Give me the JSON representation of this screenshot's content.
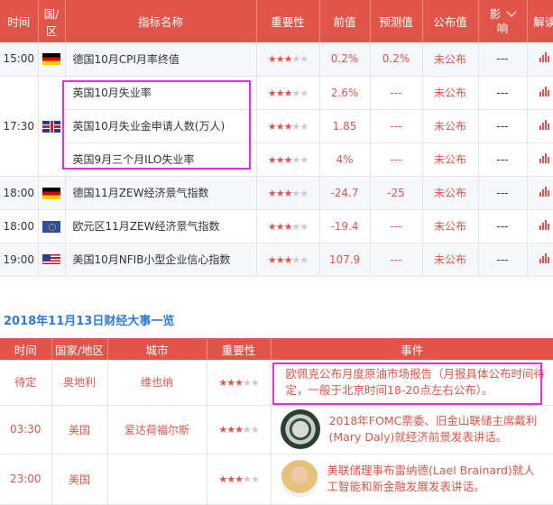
{
  "calendar": {
    "headers": {
      "time": "时间",
      "region": "国/区",
      "indicator": "指标名称",
      "importance": "重要性",
      "previous": "前值",
      "forecast": "预测值",
      "actual": "公布值",
      "impact_line1": "影",
      "impact_line2": "响",
      "analysis": "解读"
    },
    "rows": [
      {
        "time": "15:00",
        "flag": "germany-flag",
        "indicator": "德国10月CPI月率终值",
        "stars": 3,
        "previous": "0.2%",
        "forecast": "0.2%",
        "actual": "未公布",
        "impact": "---"
      },
      {
        "time": "17:30",
        "flag": "uk-flag",
        "indicator": "英国10月失业率",
        "stars": 3,
        "previous": "2.6%",
        "forecast": "---",
        "actual": "未公布",
        "impact": "---"
      },
      {
        "indicator": "英国10月失业金申请人数(万人)",
        "stars": 3,
        "previous": "1.85",
        "forecast": "---",
        "actual": "未公布",
        "impact": "---"
      },
      {
        "indicator": "英国9月三个月ILO失业率",
        "stars": 3,
        "previous": "4%",
        "forecast": "---",
        "actual": "未公布",
        "impact": "---"
      },
      {
        "time": "18:00",
        "flag": "germany-flag",
        "indicator": "德国11月ZEW经济景气指数",
        "stars": 3,
        "previous": "-24.7",
        "forecast": "-25",
        "actual": "未公布",
        "impact": "---"
      },
      {
        "time": "18:00",
        "flag": "eu-flag",
        "indicator": "欧元区11月ZEW经济景气指数",
        "stars": 3,
        "previous": "-19.4",
        "forecast": "---",
        "actual": "未公布",
        "impact": "---"
      },
      {
        "time": "19:00",
        "flag": "us-flag",
        "indicator": "美国10月NFIB小型企业信心指数",
        "stars": 3,
        "previous": "107.9",
        "forecast": "---",
        "actual": "未公布",
        "impact": "---"
      }
    ]
  },
  "events_section": {
    "title": "2018年11月13日财经大事一览",
    "headers": {
      "time": "时间",
      "country": "国家/地区",
      "city": "城市",
      "importance": "重要性",
      "event": "事件"
    },
    "rows": [
      {
        "time": "待定",
        "country": "奥地利",
        "city": "维也纳",
        "stars": 3,
        "event": "欧佩克公布月度原油市场报告（月报具体公布时间待定，一般于北京时间18-20点左右公布）。",
        "image": ""
      },
      {
        "time": "03:30",
        "country": "美国",
        "city": "爱达荷福尔斯",
        "stars": 3,
        "event": "2018年FOMC票委、旧金山联储主席戴利(Mary Daly)就经济前景发表讲话。",
        "image": "federal-reserve-seal-icon"
      },
      {
        "time": "23:00",
        "country": "美国",
        "city": "",
        "stars": 3,
        "event": "美联储理事布雷纳德(Lael Brainard)就人工智能和新金融发展发表讲话。",
        "image": "speaker-portrait"
      }
    ]
  },
  "colors": {
    "header_bg": "#e2544a",
    "accent_red": "#e2544a",
    "highlight_box": "#e62ee5",
    "title_blue": "#2f7ad6",
    "alt_row_bg": "#f6f7fb"
  }
}
